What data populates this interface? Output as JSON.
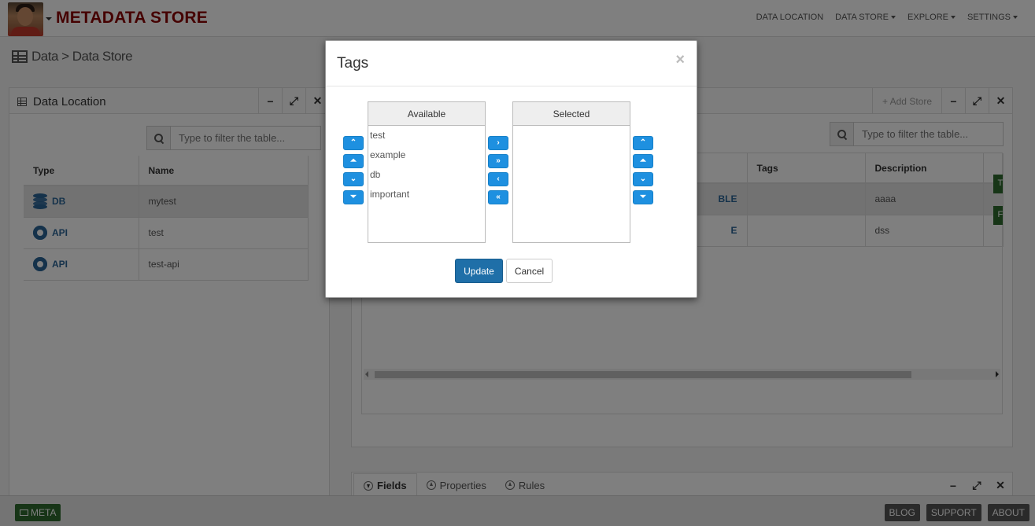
{
  "navbar": {
    "brand": "METADATA STORE",
    "menu": [
      {
        "label": "DATA LOCATION",
        "caret": false
      },
      {
        "label": "DATA STORE",
        "caret": true
      },
      {
        "label": "EXPLORE",
        "caret": true
      },
      {
        "label": "SETTINGS",
        "caret": true
      }
    ]
  },
  "breadcrumb": "Data > Data Store",
  "left_panel": {
    "title": "Data Location",
    "filter_placeholder": "Type to filter the table...",
    "columns": [
      "Type",
      "Name"
    ],
    "rows": [
      {
        "type": "DB",
        "icon": "database-icon",
        "name": "mytest",
        "selected": true
      },
      {
        "type": "API",
        "icon": "gear-icon",
        "name": "test",
        "selected": false
      },
      {
        "type": "API",
        "icon": "gear-icon",
        "name": "test-api",
        "selected": false
      }
    ]
  },
  "right_panel": {
    "add_label": "+ Add Store",
    "filter_placeholder": "Type to filter the table...",
    "columns": [
      "Tags",
      "Description"
    ],
    "rows": [
      {
        "partial": "BLE",
        "tags": "",
        "description": "aaaa",
        "tag_letter": "T"
      },
      {
        "partial": "E",
        "tags": "",
        "description": "dss",
        "tag_letter": "F"
      }
    ]
  },
  "bottom_panel": {
    "tabs": [
      "Fields",
      "Properties",
      "Rules"
    ]
  },
  "footer": {
    "meta_label": "META",
    "links": [
      "BLOG",
      "SUPPORT",
      "ABOUT"
    ]
  },
  "modal": {
    "title": "Tags",
    "close": "×",
    "available_header": "Available",
    "selected_header": "Selected",
    "available_items": [
      "test",
      "example",
      "db",
      "important"
    ],
    "selected_items": [],
    "update_label": "Update",
    "cancel_label": "Cancel"
  },
  "colors": {
    "brand": "#8b0000",
    "primary": "#1f6fa8",
    "mini_button": "#1e90e0",
    "footer_green": "#2e6b2e"
  }
}
